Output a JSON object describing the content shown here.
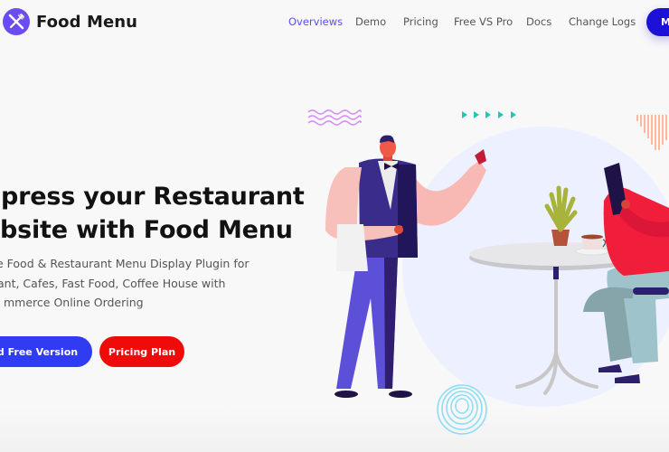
{
  "header": {
    "brand": "Food Menu",
    "logo_icon": "fork-knife-icon",
    "nav": [
      {
        "label": "Overviews",
        "active": true
      },
      {
        "label": "Demo",
        "active": false
      },
      {
        "label": "Pricing",
        "active": false
      },
      {
        "label": "Free VS Pro",
        "active": false
      },
      {
        "label": "Docs",
        "active": false
      },
      {
        "label": "Change Logs",
        "active": false
      }
    ],
    "cta_label": "M"
  },
  "hero": {
    "title_line1": "press your Restaurant",
    "title_line2": "bsite with Food Menu",
    "subtitle_line1": "e Food & Restaurant Menu Display Plugin for",
    "subtitle_line2": "ant, Cafes, Fast Food, Coffee House with",
    "subtitle_line3": "mmerce Online Ordering",
    "primary_button": "oad Free Version",
    "secondary_button": "Pricing Plan"
  },
  "illustration": {
    "description": "waiter-and-customer-at-cafe-table",
    "colors": {
      "accent_purple": "#6a4cf0",
      "nav_active": "#5b4bf0",
      "primary_button": "#2f3cf2",
      "pricing_button": "#f00a0a",
      "cta_button": "#1c10d9",
      "circle_bg": "#edf1ff",
      "wave": "#d28cf2",
      "triangles": "#1fc7b6",
      "stripes": "#ffb9a0",
      "rings": "#8fdcf6"
    }
  }
}
